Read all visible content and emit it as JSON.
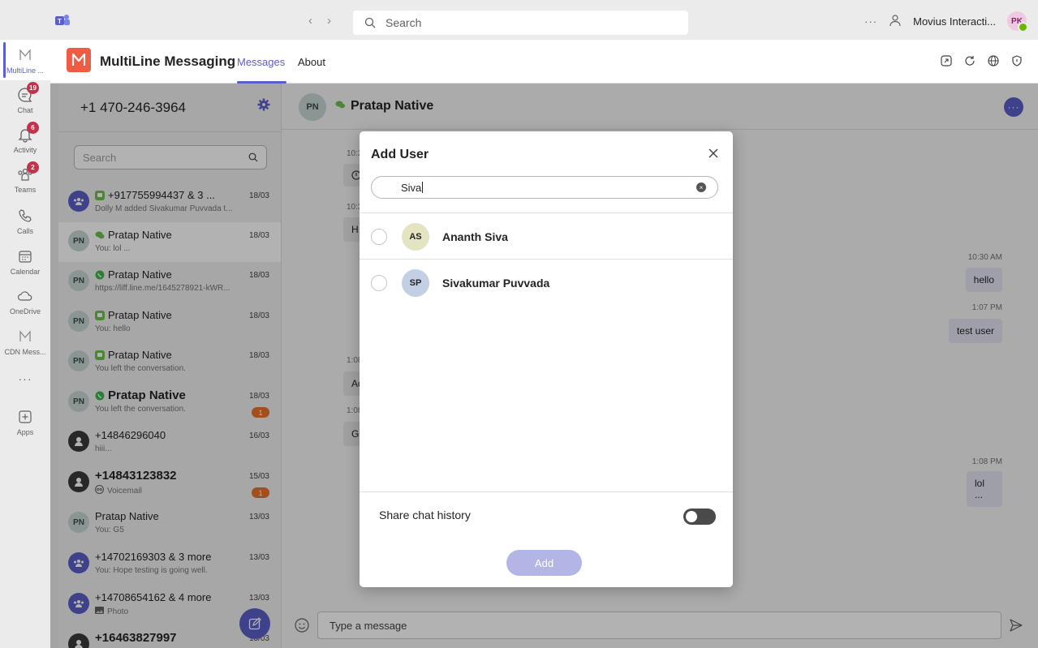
{
  "titlebar": {
    "search_placeholder": "Search",
    "more": "···",
    "org_name": "Movius Interacti...",
    "avatar_initials": "PK"
  },
  "rail": {
    "items": [
      {
        "label": "MultiLine ...",
        "icon": "multiline-logo-icon",
        "badge": ""
      },
      {
        "label": "Chat",
        "icon": "chat-icon",
        "badge": "19"
      },
      {
        "label": "Activity",
        "icon": "bell-icon",
        "badge": "6"
      },
      {
        "label": "Teams",
        "icon": "teams-icon",
        "badge": "2"
      },
      {
        "label": "Calls",
        "icon": "phone-icon",
        "badge": ""
      },
      {
        "label": "Calendar",
        "icon": "calendar-icon",
        "badge": ""
      },
      {
        "label": "OneDrive",
        "icon": "cloud-icon",
        "badge": ""
      },
      {
        "label": "CDN Mess...",
        "icon": "multiline-logo-icon",
        "badge": ""
      },
      {
        "label": "···",
        "icon": "more-icon",
        "badge": ""
      },
      {
        "label": "Apps",
        "icon": "apps-icon",
        "badge": ""
      }
    ]
  },
  "app": {
    "title": "MultiLine Messaging",
    "tabs": [
      {
        "label": "Messages"
      },
      {
        "label": "About"
      }
    ]
  },
  "convlist": {
    "phone": "+1 470-246-3964",
    "search_placeholder": "Search",
    "items": [
      {
        "avatar": "",
        "type": "group",
        "name": "+917755994437 & 3 ...",
        "channel": "sms",
        "sub": "Dolly M added Sivakumar Puvvada t...",
        "date": "18/03",
        "unread": ""
      },
      {
        "avatar": "PN",
        "type": "pn",
        "name": "Pratap Native",
        "channel": "wechat",
        "sub": "You: lol ...",
        "date": "18/03",
        "unread": ""
      },
      {
        "avatar": "PN",
        "type": "pn",
        "name": "Pratap Native",
        "channel": "whatsapp",
        "sub": "https://liff.line.me/1645278921-kWR...",
        "date": "18/03",
        "unread": ""
      },
      {
        "avatar": "PN",
        "type": "pn",
        "name": "Pratap Native",
        "channel": "sms",
        "sub": "You: hello",
        "date": "18/03",
        "unread": ""
      },
      {
        "avatar": "PN",
        "type": "pn",
        "name": "Pratap Native",
        "channel": "sms",
        "sub": "You left the conversation.",
        "date": "18/03",
        "unread": ""
      },
      {
        "avatar": "PN",
        "type": "pn",
        "name": "Pratap Native",
        "channel": "whatsapp",
        "sub": "You left the conversation.",
        "date": "18/03",
        "unread": "1"
      },
      {
        "avatar": "",
        "type": "person",
        "name": "+14846296040",
        "channel": "",
        "sub": "hiii...",
        "date": "16/03",
        "unread": ""
      },
      {
        "avatar": "",
        "type": "person",
        "name": "+14843123832",
        "channel": "",
        "sub": "Voicemail",
        "date": "15/03",
        "unread": "1"
      },
      {
        "avatar": "PN",
        "type": "pn",
        "name": "Pratap Native",
        "channel": "",
        "sub": "You: G5",
        "date": "13/03",
        "unread": ""
      },
      {
        "avatar": "",
        "type": "group",
        "name": "+14702169303 & 3 more",
        "channel": "",
        "sub": "You: Hope testing is going well.",
        "date": "13/03",
        "unread": ""
      },
      {
        "avatar": "",
        "type": "group",
        "name": "+14708654162 & 4 more",
        "channel": "",
        "sub": "Photo",
        "date": "13/03",
        "unread": ""
      },
      {
        "avatar": "",
        "type": "person",
        "name": "+16463827997",
        "channel": "",
        "sub": "",
        "date": "13/03",
        "unread": ""
      }
    ]
  },
  "chat": {
    "header_initials": "PN",
    "header_name": "Pratap Native",
    "incoming": [
      {
        "time": "10:3",
        "text": ""
      },
      {
        "time": "10:3",
        "text": "H"
      },
      {
        "time": "1:08",
        "text": "Ac"
      },
      {
        "time": "1:08",
        "text": "G"
      }
    ],
    "outgoing": [
      {
        "time": "10:30 AM",
        "text": "hello"
      },
      {
        "time": "1:07 PM",
        "text": "test user"
      },
      {
        "time": "1:08 PM",
        "text": "lol\n..."
      }
    ],
    "composer_placeholder": "Type a message"
  },
  "modal": {
    "title": "Add User",
    "search_value": "Siva",
    "users": [
      {
        "initials": "AS",
        "name": "Ananth Siva",
        "color": "#e4e4c2"
      },
      {
        "initials": "SP",
        "name": "Sivakumar Puvvada",
        "color": "#c2cfe4"
      }
    ],
    "share_label": "Share chat history",
    "share_on": false,
    "add_label": "Add"
  }
}
